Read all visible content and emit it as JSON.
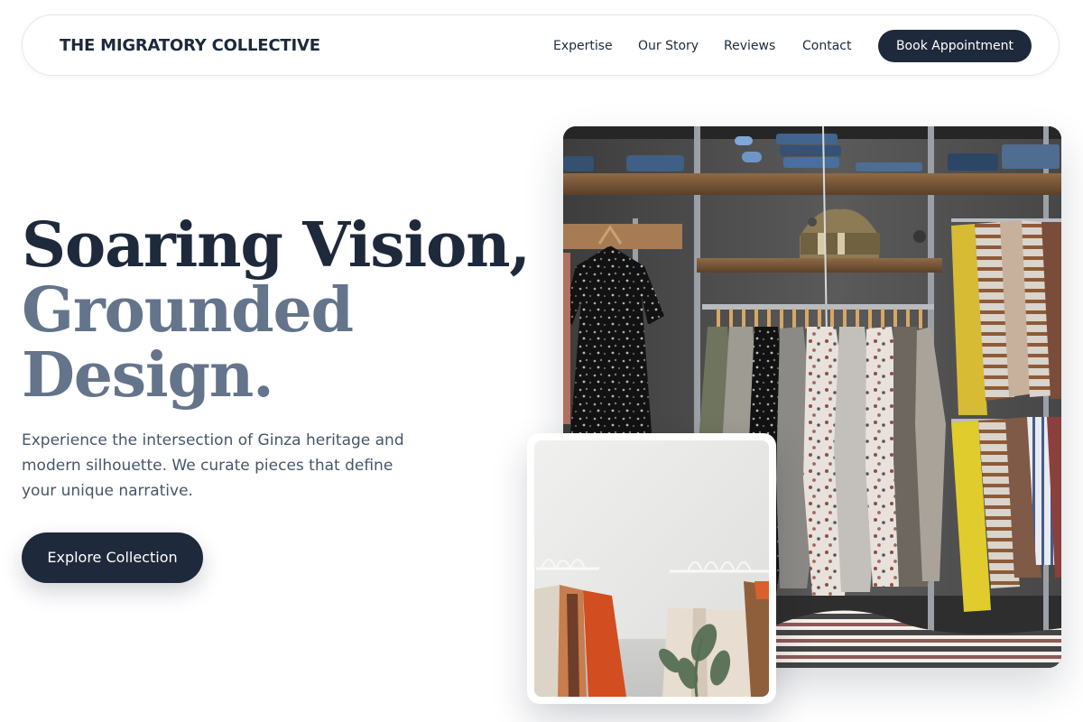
{
  "header": {
    "brand": "THE MIGRATORY COLLECTIVE",
    "nav": {
      "expertise": "Expertise",
      "story": "Our Story",
      "reviews": "Reviews",
      "contact": "Contact"
    },
    "cta": "Book Appointment"
  },
  "hero": {
    "title_line_1": "Soaring Vision,",
    "title_line_2": "Grounded",
    "title_line_3": "Design.",
    "description": "Experience the intersection of Ginza heritage and modern silhouette. We curate pieces that define your unique narrative.",
    "cta": "Explore Collection"
  },
  "images": {
    "main": "boutique-clothing-racks-image",
    "secondary": "minimal-clothing-rack-image"
  },
  "colors": {
    "navy": "#1e293b",
    "slate": "#64748b",
    "text": "#475569",
    "border": "#e5e7eb"
  }
}
